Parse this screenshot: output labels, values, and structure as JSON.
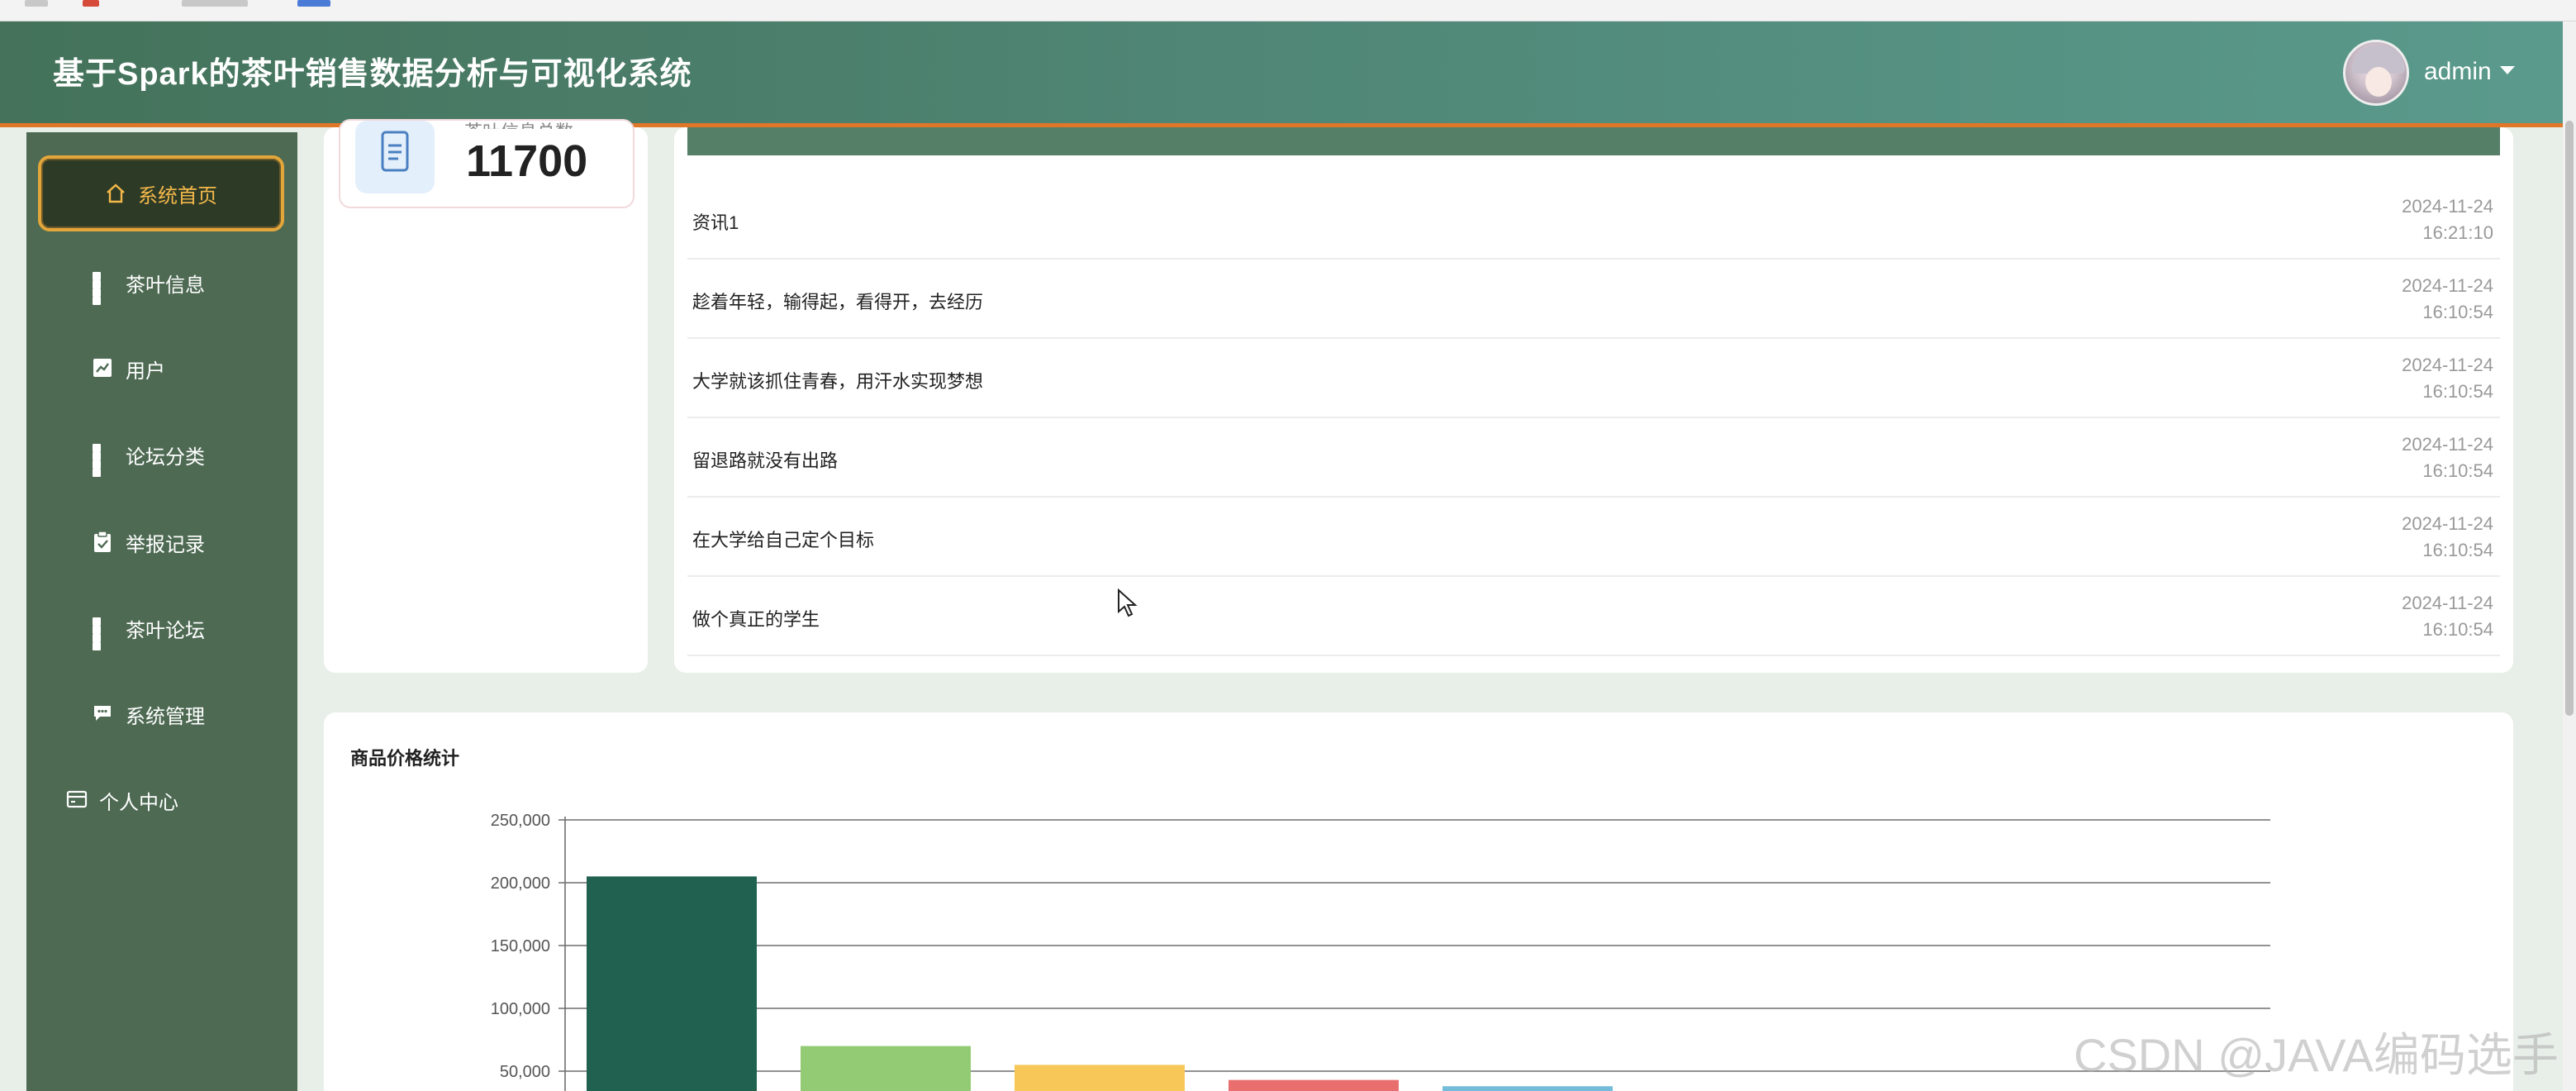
{
  "header": {
    "title": "基于Spark的茶叶销售数据分析与可视化系统",
    "username": "admin"
  },
  "sidebar": {
    "items": [
      {
        "label": "系统首页",
        "icon": "home-icon",
        "active": true
      },
      {
        "label": "茶叶信息",
        "icon": "grid-icon"
      },
      {
        "label": "用户",
        "icon": "chart-icon"
      },
      {
        "label": "论坛分类",
        "icon": "grid-icon"
      },
      {
        "label": "举报记录",
        "icon": "clipboard-icon"
      },
      {
        "label": "茶叶论坛",
        "icon": "grid-icon"
      },
      {
        "label": "系统管理",
        "icon": "message-icon"
      },
      {
        "label": "个人中心",
        "icon": "card-icon"
      }
    ]
  },
  "stat": {
    "label": "茶叶信息总数",
    "value": "11700",
    "icon": "document-icon"
  },
  "news": [
    {
      "title": "资讯1",
      "date": "2024-11-24",
      "time": "16:21:10"
    },
    {
      "title": "趁着年轻，输得起，看得开，去经历",
      "date": "2024-11-24",
      "time": "16:10:54"
    },
    {
      "title": "大学就该抓住青春，用汗水实现梦想",
      "date": "2024-11-24",
      "time": "16:10:54"
    },
    {
      "title": "留退路就没有出路",
      "date": "2024-11-24",
      "time": "16:10:54"
    },
    {
      "title": "在大学给自己定个目标",
      "date": "2024-11-24",
      "time": "16:10:54"
    },
    {
      "title": "做个真正的学生",
      "date": "2024-11-24",
      "time": "16:10:54"
    }
  ],
  "chart_data": {
    "type": "bar",
    "title": "商品价格统计",
    "xlabel": "",
    "ylabel": "",
    "ylim": [
      0,
      250000
    ],
    "yticks": [
      "50,000",
      "100,000",
      "150,000",
      "200,000",
      "250,000"
    ],
    "ytick_values": [
      50000,
      100000,
      150000,
      200000,
      250000
    ],
    "grid": true,
    "values": [
      205000,
      70000,
      55000,
      43000,
      38000
    ],
    "colors": [
      "#206150",
      "#92cb74",
      "#f7c758",
      "#e96e6e",
      "#74bcd9"
    ]
  },
  "watermark": "CSDN @JAVA编码选手",
  "colors": {
    "header": "#4f8574",
    "accent": "#e07628",
    "sidebar": "#4e6a53",
    "active": "#f4b84a"
  }
}
